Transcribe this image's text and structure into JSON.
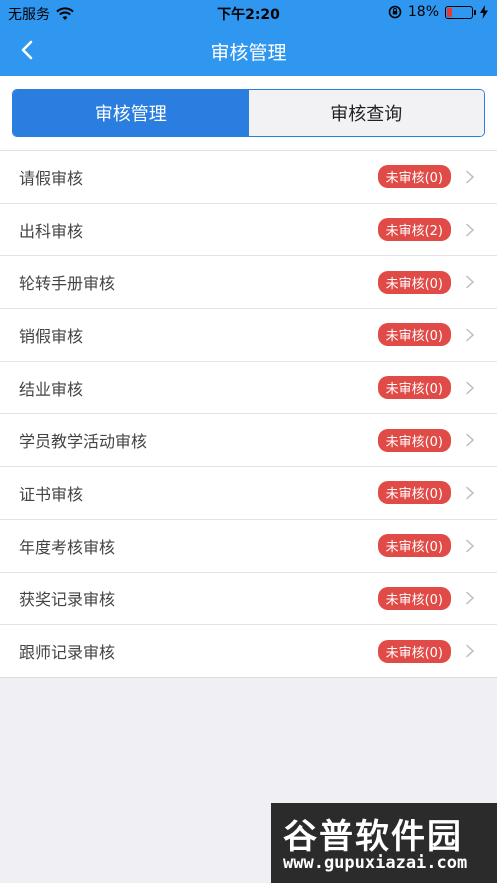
{
  "status": {
    "carrier": "无服务",
    "time": "下午2:20",
    "battery": "18%",
    "battery_level": 0.18,
    "icons": [
      "wifi-icon",
      "orientation-lock-icon",
      "battery-icon",
      "charging-bolt-icon"
    ]
  },
  "nav": {
    "title": "审核管理",
    "back_icon": "chevron-left-icon"
  },
  "tabs": [
    {
      "label": "审核管理",
      "active": true
    },
    {
      "label": "审核查询",
      "active": false
    }
  ],
  "items": [
    {
      "label": "请假审核",
      "badge": "未审核(0)"
    },
    {
      "label": "出科审核",
      "badge": "未审核(2)"
    },
    {
      "label": "轮转手册审核",
      "badge": "未审核(0)"
    },
    {
      "label": "销假审核",
      "badge": "未审核(0)"
    },
    {
      "label": "结业审核",
      "badge": "未审核(0)"
    },
    {
      "label": "学员教学活动审核",
      "badge": "未审核(0)"
    },
    {
      "label": "证书审核",
      "badge": "未审核(0)"
    },
    {
      "label": "年度考核审核",
      "badge": "未审核(0)"
    },
    {
      "label": "获奖记录审核",
      "badge": "未审核(0)"
    },
    {
      "label": "跟师记录审核",
      "badge": "未审核(0)"
    }
  ],
  "watermark": {
    "brand": "谷普软件园",
    "url": "www.gupuxiazai.com"
  },
  "colors": {
    "primary": "#2f97f0",
    "tab_active": "#2a7ee0",
    "badge": "#e04b47"
  }
}
